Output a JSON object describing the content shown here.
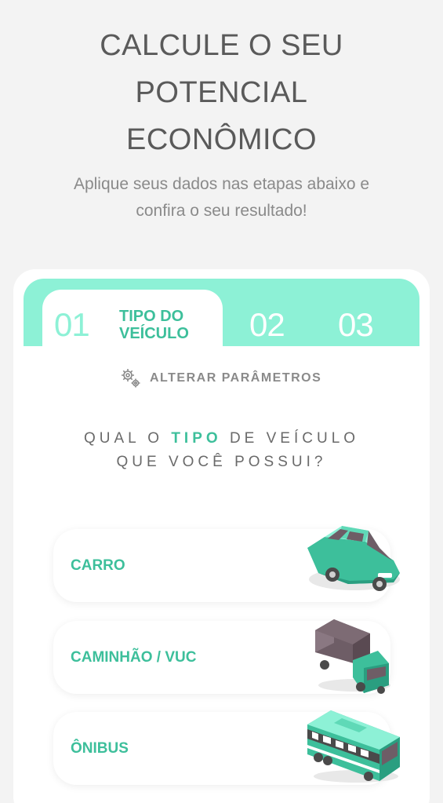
{
  "header": {
    "title_lines": [
      "CALCULE O SEU",
      "POTENCIAL",
      "ECONÔMICO"
    ],
    "subtitle": "Aplique seus dados nas etapas abaixo e confira o seu resultado!"
  },
  "steps": {
    "tabs": [
      {
        "number": "01",
        "label_line1": "TIPO DO",
        "label_line2": "VEÍCULO",
        "active": true
      },
      {
        "number": "02",
        "active": false
      },
      {
        "number": "03",
        "active": false
      }
    ]
  },
  "params": {
    "label": "ALTERAR PARÂMETROS",
    "icon": "gears-icon"
  },
  "question": {
    "line1_before": "QUAL O",
    "line1_highlight": "TIPO",
    "line1_after": "DE VEÍCULO",
    "line2": "QUE VOCÊ POSSUI?"
  },
  "vehicles": [
    {
      "label": "CARRO",
      "icon": "car-icon"
    },
    {
      "label": "CAMINHÃO / VUC",
      "icon": "truck-icon"
    },
    {
      "label": "ÔNIBUS",
      "icon": "bus-icon"
    }
  ],
  "colors": {
    "accent": "#3dbf9b",
    "tab_bg": "#8df1d6",
    "truck_box": "#6e5d66"
  }
}
